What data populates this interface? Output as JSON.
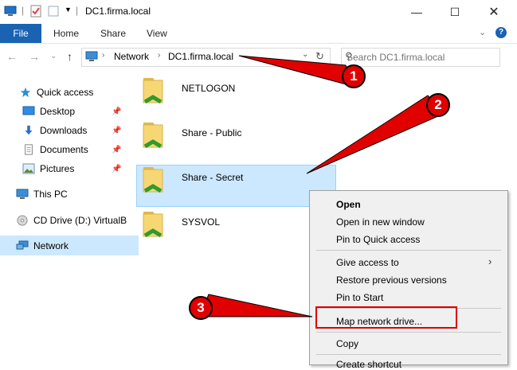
{
  "window": {
    "title": "DC1.firma.local"
  },
  "ribbon": {
    "tabs": [
      "File",
      "Home",
      "Share",
      "View"
    ]
  },
  "address": {
    "crumbs": [
      "Network",
      "DC1.firma.local"
    ]
  },
  "search": {
    "placeholder": "Search DC1.firma.local"
  },
  "sidebar": {
    "items": [
      {
        "label": "Quick access",
        "icon": "star-icon"
      },
      {
        "label": "Desktop",
        "icon": "desktop-icon"
      },
      {
        "label": "Downloads",
        "icon": "download-icon"
      },
      {
        "label": "Documents",
        "icon": "document-icon"
      },
      {
        "label": "Pictures",
        "icon": "pictures-icon"
      },
      {
        "label": "This PC",
        "icon": "computer-icon"
      },
      {
        "label": "CD Drive (D:) VirtualB",
        "icon": "cd-icon"
      },
      {
        "label": "Network",
        "icon": "network-icon"
      }
    ]
  },
  "folders": [
    {
      "name": "NETLOGON"
    },
    {
      "name": "Share - Public"
    },
    {
      "name": "Share - Secret"
    },
    {
      "name": "SYSVOL"
    }
  ],
  "context_menu": {
    "items": [
      "Open",
      "Open in new window",
      "Pin to Quick access",
      "Give access to",
      "Restore previous versions",
      "Pin to Start",
      "Map network drive...",
      "Copy",
      "Create shortcut"
    ]
  },
  "annotations": {
    "step1": "1",
    "step2": "2",
    "step3": "3"
  },
  "colors": {
    "accent": "#1a62b2",
    "annotation_red": "#e00000",
    "selection": "#cce8ff"
  }
}
